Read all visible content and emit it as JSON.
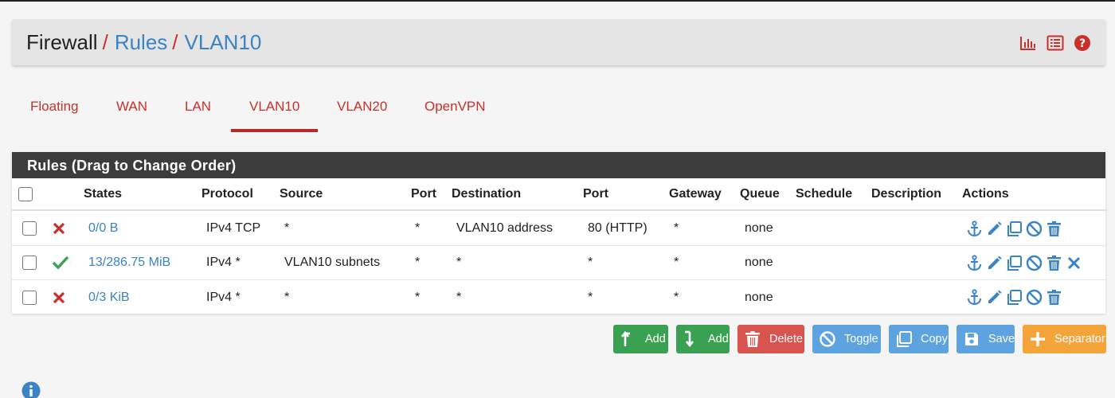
{
  "breadcrumb": {
    "first": "Firewall",
    "second": "Rules",
    "third": "VLAN10",
    "separator": "/"
  },
  "header_icons": [
    "chart-icon",
    "list-icon",
    "help-icon"
  ],
  "tabs": [
    {
      "label": "Floating",
      "active": false
    },
    {
      "label": "WAN",
      "active": false
    },
    {
      "label": "LAN",
      "active": false
    },
    {
      "label": "VLAN10",
      "active": true
    },
    {
      "label": "VLAN20",
      "active": false
    },
    {
      "label": "OpenVPN",
      "active": false
    }
  ],
  "panel": {
    "title": "Rules (Drag to Change Order)",
    "columns": [
      "States",
      "Protocol",
      "Source",
      "Port",
      "Destination",
      "Port",
      "Gateway",
      "Queue",
      "Schedule",
      "Description",
      "Actions"
    ]
  },
  "rules": [
    {
      "status": "blocked",
      "states": "0/0 B",
      "protocol": "IPv4 TCP",
      "source": "*",
      "source_port": "*",
      "destination": "VLAN10 address",
      "dest_port": "80 (HTTP)",
      "gateway": "*",
      "queue": "none",
      "schedule": "",
      "description": "",
      "actions": [
        "anchor-icon",
        "pencil-icon",
        "copy-icon",
        "disable-icon",
        "trash-icon"
      ]
    },
    {
      "status": "passed",
      "states": "13/286.75 MiB",
      "protocol": "IPv4 *",
      "source": "VLAN10 subnets",
      "source_port": "*",
      "destination": "*",
      "dest_port": "*",
      "gateway": "*",
      "queue": "none",
      "schedule": "",
      "description": "",
      "actions": [
        "anchor-icon",
        "pencil-icon",
        "copy-icon",
        "disable-icon",
        "trash-icon",
        "close-icon"
      ]
    },
    {
      "status": "blocked",
      "states": "0/3 KiB",
      "protocol": "IPv4 *",
      "source": "*",
      "source_port": "*",
      "destination": "*",
      "dest_port": "*",
      "gateway": "*",
      "queue": "none",
      "schedule": "",
      "description": "",
      "actions": [
        "anchor-icon",
        "pencil-icon",
        "copy-icon",
        "disable-icon",
        "trash-icon"
      ]
    }
  ],
  "buttons": {
    "add_top": "Add",
    "add_bottom": "Add",
    "delete": "Delete",
    "toggle": "Toggle",
    "copy": "Copy",
    "save": "Save",
    "separator": "Separator"
  },
  "colors": {
    "accent_red": "#c8302a",
    "link_blue": "#3a83c4",
    "panel_header": "#3c3c3c",
    "green": "#3ba152",
    "red": "#d9534f",
    "blue": "#5ca3df",
    "orange": "#f5a43a"
  }
}
